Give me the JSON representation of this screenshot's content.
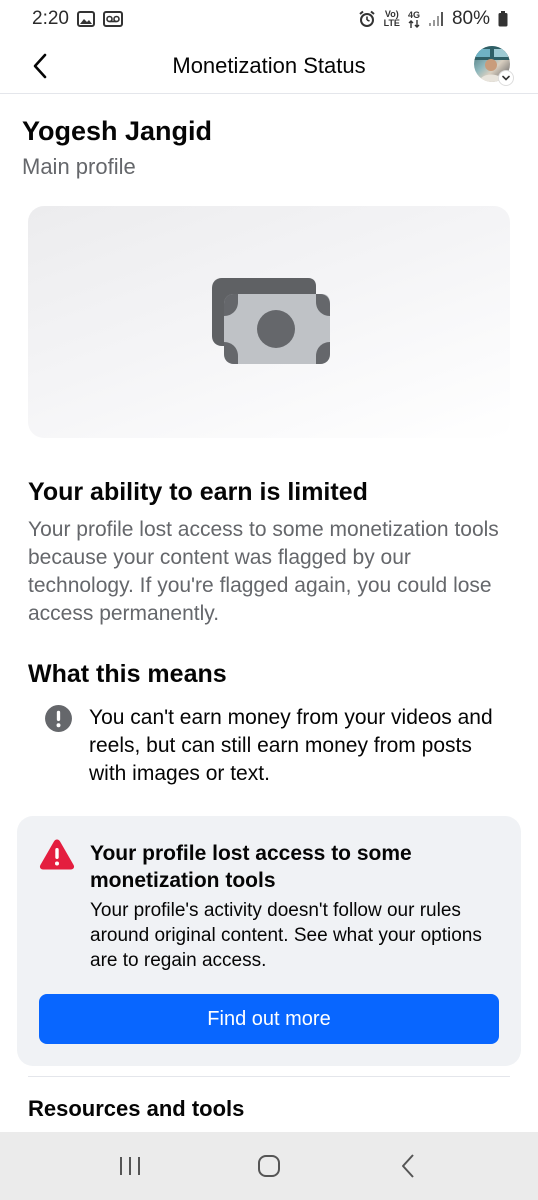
{
  "status_bar": {
    "time": "2:20",
    "network_top": "Vo)",
    "network_bottom": "LTE",
    "data_type": "4G",
    "battery": "80%"
  },
  "header": {
    "title": "Monetization Status",
    "icons": {
      "back": "chevron-left-icon",
      "account": "avatar"
    }
  },
  "profile": {
    "name": "Yogesh Jangid",
    "type": "Main profile"
  },
  "hero": {
    "icon": "money-icon",
    "colors": {
      "back_bill": "#5f6164",
      "front_bill": "#bfc2c6",
      "coin": "#65676b"
    }
  },
  "limited": {
    "heading": "Your ability to earn is limited",
    "body": "Your profile lost access to some monetization tools because your content was flagged by our technology. If you're flagged again, you could lose access permanently."
  },
  "means": {
    "heading": "What this means",
    "item_text": "You can't earn money from your videos and reels, but can still earn money from posts with images or text.",
    "icon": "info-exclamation-icon"
  },
  "alert": {
    "title": "Your profile lost access to some monetization tools",
    "body": "Your profile's activity doesn't follow our rules around original content. See what your options are to regain access.",
    "button_label": "Find out more",
    "icon": "warning-triangle-icon",
    "colors": {
      "warning": "#e41e3f",
      "button": "#0866ff",
      "card_bg": "#f0f2f5"
    }
  },
  "resources": {
    "heading": "Resources and tools"
  },
  "nav_bar": {
    "icons": [
      "recent-apps-icon",
      "home-icon",
      "back-icon"
    ]
  }
}
